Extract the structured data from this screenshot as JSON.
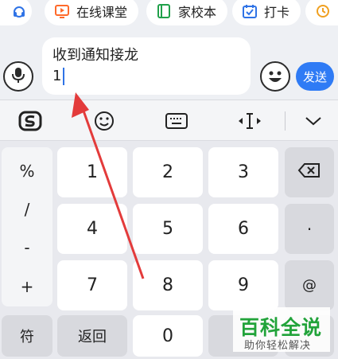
{
  "tools": [
    {
      "label": "在线课堂",
      "icon": "video-lesson-icon"
    },
    {
      "label": "家校本",
      "icon": "notebook-icon"
    },
    {
      "label": "打卡",
      "icon": "check-in-icon"
    }
  ],
  "input": {
    "line1": "收到通知接龙",
    "line2": "1"
  },
  "send_label": "发送",
  "keys": {
    "symbols": [
      "%",
      "/",
      "-",
      "+"
    ],
    "row1": [
      "1",
      "2",
      "3"
    ],
    "row2": [
      "4",
      "5",
      "6"
    ],
    "row3": [
      "7",
      "8",
      "9"
    ],
    "dot": "·",
    "at": "@",
    "fu": "符",
    "back": "返回",
    "zero": "0"
  },
  "watermark": {
    "title": "百科全说",
    "subtitle": "助你轻松解决"
  },
  "colors": {
    "accent": "#2f7bf5",
    "chip_icon": "#ff6a2a",
    "annotation": "#e33b3b",
    "watermark": "#21a33a"
  }
}
